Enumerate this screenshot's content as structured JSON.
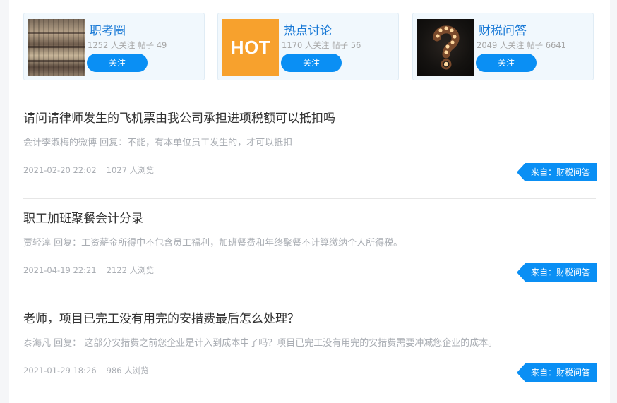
{
  "cards": [
    {
      "title": "职考圈",
      "stats": "1252 人关注 帖子 49",
      "follow_label": "关注",
      "thumb": "books-photo"
    },
    {
      "title": "热点讨论",
      "stats": "1170 人关注 帖子 56",
      "follow_label": "关注",
      "thumb_text": "HOT"
    },
    {
      "title": "财税问答",
      "stats": "2049 人关注 帖子 6641",
      "follow_label": "关注",
      "thumb": "question-mark-lights-photo"
    }
  ],
  "questions": [
    {
      "title": "请问请律师发生的飞机票由我公司承担进项税额可以抵扣吗",
      "reply": "会计李淑梅的微博 回复：不能，有本单位员工发生的，才可以抵扣",
      "date": "2021-02-20 22:02",
      "views": "1027 人浏览",
      "source": "来自：财税问答"
    },
    {
      "title": "职工加班聚餐会计分录",
      "reply": "贾轻淳 回复：工资薪金所得中不包含员工福利，加班餐费和年终聚餐不计算缴纳个人所得税。",
      "date": "2021-04-19 22:21",
      "views": "2122 人浏览",
      "source": "来自：财税问答"
    },
    {
      "title": "老师，项目已完工没有用完的安措费最后怎么处理？",
      "reply": "泰海凡 回复： 这部分安措费之前您企业是计入到成本中了吗？项目已完工没有用完的安措费需要冲减您企业的成本。",
      "date": "2021-01-29 18:26",
      "views": "986 人浏览",
      "source": "来自：财税问答"
    }
  ],
  "colors": {
    "accent": "#0a8ff4",
    "card_title": "#1a7ad6",
    "hot_bg": "#f7a12d"
  }
}
